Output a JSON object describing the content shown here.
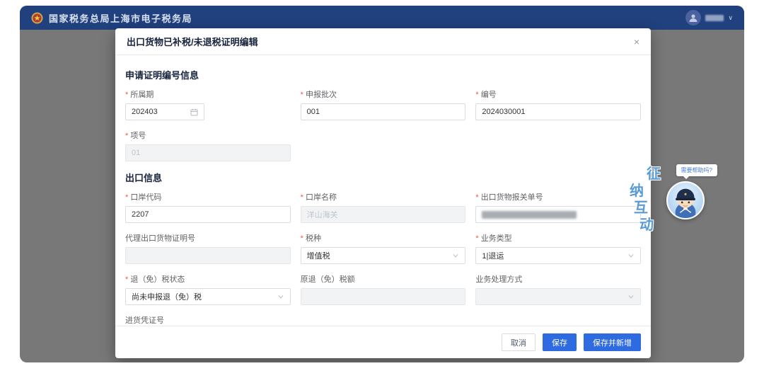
{
  "colors": {
    "topbar_bg": "#20407e",
    "primary_button": "#2e6ae0",
    "overlay_gray": "#787878",
    "required_asterisk": "#f25643"
  },
  "topbar": {
    "title": "国家税务总局上海市电子税务局",
    "emblem_icon": "national-emblem-icon",
    "user_icon": "user-avatar-icon",
    "caret_icon": "chevron-down-icon",
    "caret_glyph": "∨"
  },
  "modal": {
    "title": "出口货物已补税/未退税证明编辑",
    "close_glyph": "×",
    "section_apply": "申请证明编号信息",
    "section_export": "出口信息",
    "fields": {
      "period": {
        "label": "所属期",
        "value": "202403"
      },
      "batch": {
        "label": "申报批次",
        "value": "001"
      },
      "number": {
        "label": "编号",
        "value": "2024030001"
      },
      "item_no": {
        "label": "项号",
        "value": "01"
      },
      "port_code": {
        "label": "口岸代码",
        "value": "2207"
      },
      "port_name": {
        "label": "口岸名称",
        "value": "洋山海关"
      },
      "customs_no": {
        "label": "出口货物报关单号",
        "value": ""
      },
      "agent_cert_no": {
        "label": "代理出口货物证明号",
        "value": ""
      },
      "tax_type": {
        "label": "税种",
        "value": "增值税"
      },
      "business_type": {
        "label": "业务类型",
        "value": "1|退运"
      },
      "refund_status": {
        "label": "退（免）税状态",
        "value": "尚未申报退（免）税"
      },
      "original_refund": {
        "label": "原退（免）税额",
        "value": ""
      },
      "process_method": {
        "label": "业务处理方式",
        "value": ""
      },
      "purchase_voucher": {
        "label": "进货凭证号",
        "value": ""
      }
    },
    "buttons": {
      "cancel": "取消",
      "save": "保存",
      "save_new": "保存并新增"
    }
  },
  "assistant": {
    "bubble": "需要帮助吗?",
    "label_chars": [
      "征",
      "纳",
      "互",
      "动"
    ]
  }
}
